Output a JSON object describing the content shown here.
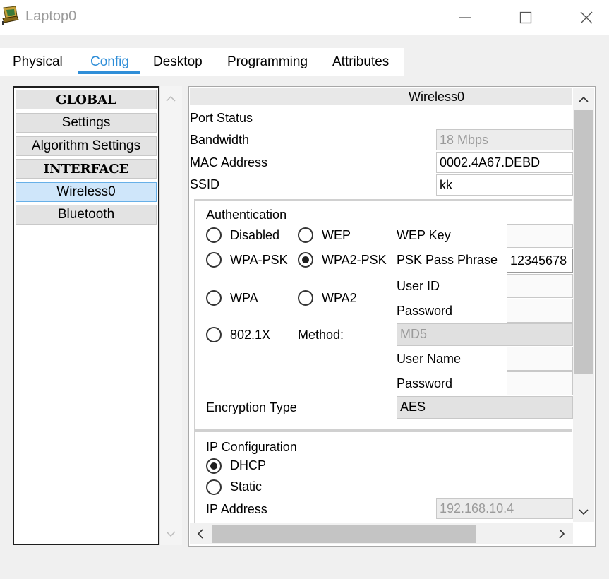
{
  "window": {
    "title": "Laptop0",
    "app_icon": "laptop-app-icon",
    "controls": {
      "minimize": "minimize-icon",
      "maximize": "maximize-icon",
      "close": "close-icon"
    }
  },
  "tabs": [
    {
      "label": "Physical",
      "active": false
    },
    {
      "label": "Config",
      "active": true
    },
    {
      "label": "Desktop",
      "active": false
    },
    {
      "label": "Programming",
      "active": false
    },
    {
      "label": "Attributes",
      "active": false
    }
  ],
  "sidebar": {
    "items": [
      {
        "label": "GLOBAL",
        "type": "header"
      },
      {
        "label": "Settings",
        "type": "item"
      },
      {
        "label": "Algorithm Settings",
        "type": "item"
      },
      {
        "label": "INTERFACE",
        "type": "header"
      },
      {
        "label": "Wireless0",
        "type": "item",
        "selected": true
      },
      {
        "label": "Bluetooth",
        "type": "item"
      }
    ]
  },
  "panel": {
    "header": "Wireless0",
    "port_status_label": "Port Status",
    "bandwidth_label": "Bandwidth",
    "bandwidth_value": "18 Mbps",
    "mac_label": "MAC Address",
    "mac_value": "0002.4A67.DEBD",
    "ssid_label": "SSID",
    "ssid_value": "kk"
  },
  "auth": {
    "title": "Authentication",
    "options": {
      "disabled": "Disabled",
      "wep": "WEP",
      "wpa_psk": "WPA-PSK",
      "wpa2_psk": "WPA2-PSK",
      "wpa": "WPA",
      "wpa2": "WPA2",
      "dot1x": "802.1X"
    },
    "selected": "WPA2-PSK",
    "wep_key_label": "WEP Key",
    "psk_label": "PSK Pass Phrase",
    "psk_value": "12345678",
    "user_id_label": "User ID",
    "password_label": "Password",
    "method_label": "Method:",
    "method_value": "MD5",
    "user_name_label": "User Name",
    "password2_label": "Password",
    "encryption_label": "Encryption Type",
    "encryption_value": "AES"
  },
  "ip": {
    "title": "IP Configuration",
    "dhcp_label": "DHCP",
    "static_label": "Static",
    "selected": "DHCP",
    "address_label": "IP Address",
    "address_value": "192.168.10.4"
  },
  "colors": {
    "accent": "#2f8ed8",
    "selected_bg": "#cfe6fa"
  }
}
